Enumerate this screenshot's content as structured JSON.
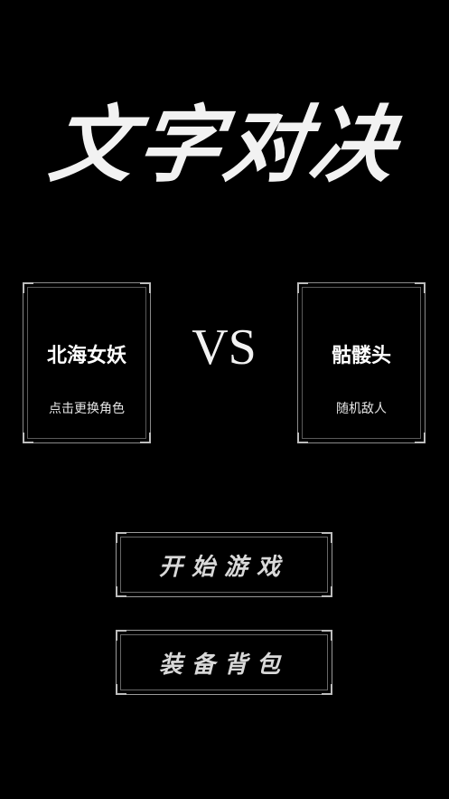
{
  "title": "文字对决",
  "player": {
    "name": "北海女妖",
    "hint": "点击更换角色"
  },
  "vs": "VS",
  "enemy": {
    "name": "骷髅头",
    "hint": "随机敌人"
  },
  "buttons": {
    "start": "开始游戏",
    "bag": "装备背包"
  }
}
